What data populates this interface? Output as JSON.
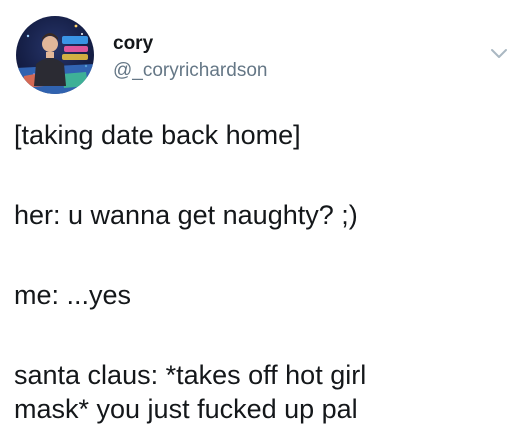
{
  "author": {
    "display_name": "cory",
    "handle": "@_coryrichardson"
  },
  "tweet": {
    "lines": [
      "[taking date back home]",
      "her: u wanna get naughty? ;)",
      "me: ...yes",
      "santa claus: *takes off hot girl",
      "mask* you just fucked up pal"
    ]
  },
  "icons": {
    "avatar": "avatar-photo",
    "menu": "chevron-down-icon"
  },
  "colors": {
    "text": "#14171a",
    "secondary": "#657786",
    "chevron": "#aab8c2"
  }
}
